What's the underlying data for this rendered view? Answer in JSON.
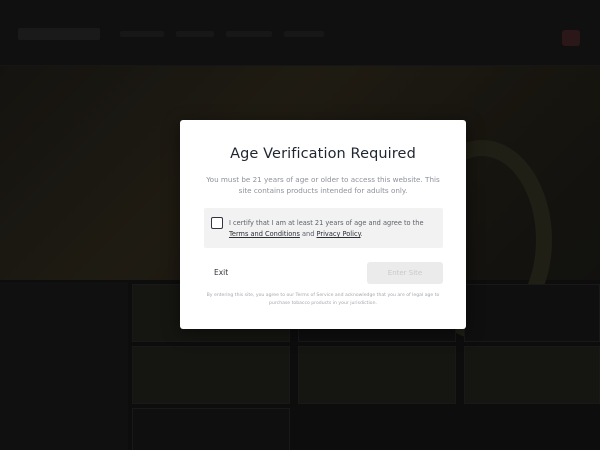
{
  "modal": {
    "title": "Age Verification Required",
    "description": "You must be 21 years of age or older to access this website. This site contains products intended for adults only.",
    "certify": {
      "checked": false,
      "text_before": "I certify that I am at least 21 years of age and agree to the ",
      "terms_link": "Terms and Conditions",
      "conjunction": " and ",
      "privacy_link": "Privacy Policy",
      "text_after": "."
    },
    "exit_label": "Exit",
    "enter_label": "Enter Site",
    "fine_print": "By entering this site, you agree to our Terms of Service and acknowledge that you are of legal age to purchase tobacco products in your jurisdiction."
  },
  "colors": {
    "overlay": "#000000",
    "modal_bg": "#ffffff",
    "title": "#1f2630",
    "certify_bg": "#f2f2f2",
    "enter_disabled_bg": "#ebebeb"
  }
}
